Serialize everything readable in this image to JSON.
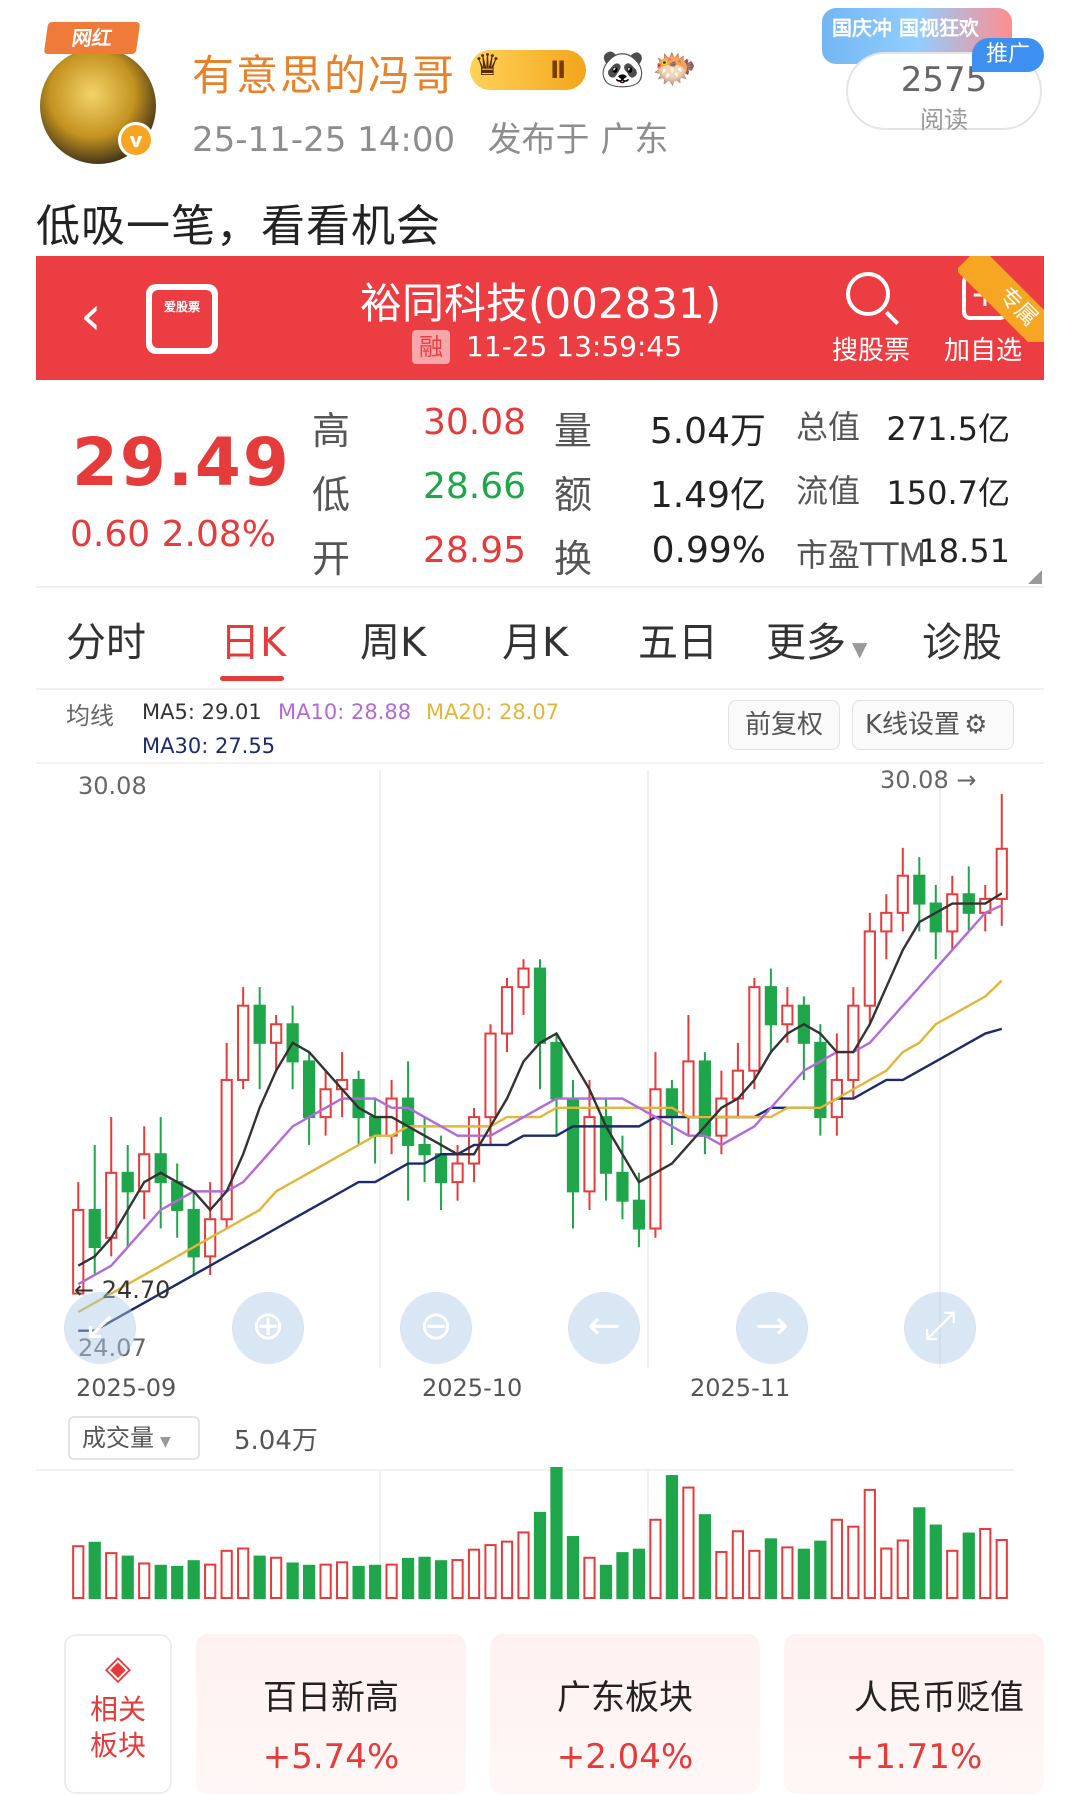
{
  "post": {
    "avatar_tag": "网红",
    "username": "有意思的冯哥",
    "level_badge": "Ⅱ",
    "timestamp": "25-11-25 14:00",
    "location": "发布于 广东",
    "ad_art_text": "国庆冲 国视狂欢",
    "ad_tag": "推广",
    "reads_count": "2575",
    "reads_label": "阅读",
    "text": "低吸一笔，看看机会"
  },
  "app": {
    "logo_text": "爱股票",
    "stock_title": "裕同科技(002831)",
    "margin_tag": "融",
    "quote_time": "11-25 13:59:45",
    "search_label": "搜股票",
    "add_label": "加自选",
    "vip_tag": "专属"
  },
  "quote": {
    "price": "29.49",
    "change": "0.60",
    "change_pct": "2.08%",
    "high_label": "高",
    "high": "30.08",
    "low_label": "低",
    "low": "28.66",
    "open_label": "开",
    "open": "28.95",
    "vol_label": "量",
    "vol": "5.04万",
    "amount_label": "额",
    "amount": "1.49亿",
    "turnover_label": "换",
    "turnover": "0.99%",
    "mktcap_label": "总值",
    "mktcap": "271.5亿",
    "float_label": "流值",
    "float_cap": "150.7亿",
    "pe_label": "市盈TTM",
    "pe": "18.51"
  },
  "tabs": [
    "分时",
    "日K",
    "周K",
    "月K",
    "五日",
    "更多",
    "诊股"
  ],
  "active_tab": "日K",
  "ma": {
    "label": "均线",
    "ma5": "MA5: 29.01",
    "ma10": "MA10: 28.88",
    "ma20": "MA20: 28.07",
    "ma30": "MA30: 27.55",
    "colors": {
      "ma5": "#333333",
      "ma10": "#b36ad8",
      "ma20": "#e3b53a",
      "ma30": "#1b2a6b"
    }
  },
  "buttons": {
    "adjust": "前复权",
    "kline_settings": "K线设置"
  },
  "chart_labels": {
    "top_left": "30.08",
    "top_right": "30.08 →",
    "low_marker": "← 24.70",
    "bottom_left": "24.07",
    "dates": [
      "2025-09",
      "2025-10",
      "2025-11"
    ]
  },
  "volume": {
    "selector": "成交量",
    "value": "5.04万"
  },
  "sectors_label": "相关板块",
  "sectors": [
    {
      "name": "百日新高",
      "change": "+5.74%"
    },
    {
      "name": "广东板块",
      "change": "+2.04%"
    },
    {
      "name": "人民币贬值",
      "change": "+1.71%"
    }
  ],
  "chart_data": {
    "type": "candlestick",
    "ylim": [
      24.07,
      30.08
    ],
    "x": [
      "2025-09",
      "2025-10",
      "2025-11"
    ],
    "up_color": "#e63b3b",
    "down_color": "#1fa64a",
    "candles": [
      [
        24.7,
        25.6,
        24.7,
        25.9
      ],
      [
        25.6,
        25.2,
        24.9,
        26.3
      ],
      [
        25.3,
        26.0,
        25.1,
        26.6
      ],
      [
        26.0,
        25.8,
        25.2,
        26.3
      ],
      [
        25.8,
        26.2,
        25.5,
        26.5
      ],
      [
        26.2,
        25.9,
        25.4,
        26.6
      ],
      [
        25.9,
        25.6,
        25.3,
        26.1
      ],
      [
        25.6,
        25.1,
        24.9,
        25.8
      ],
      [
        25.1,
        25.5,
        24.9,
        25.9
      ],
      [
        25.5,
        27.0,
        25.4,
        27.4
      ],
      [
        27.0,
        27.8,
        26.9,
        28.0
      ],
      [
        27.8,
        27.4,
        26.9,
        28.0
      ],
      [
        27.4,
        27.6,
        27.1,
        27.7
      ],
      [
        27.6,
        27.2,
        26.9,
        27.8
      ],
      [
        27.2,
        26.6,
        26.3,
        27.3
      ],
      [
        26.6,
        26.9,
        26.4,
        27.1
      ],
      [
        26.9,
        27.0,
        26.6,
        27.3
      ],
      [
        27.0,
        26.6,
        26.3,
        27.1
      ],
      [
        26.6,
        26.4,
        26.1,
        26.8
      ],
      [
        26.4,
        26.8,
        26.2,
        27.0
      ],
      [
        26.8,
        26.3,
        25.7,
        27.2
      ],
      [
        26.3,
        26.2,
        25.9,
        26.6
      ],
      [
        26.2,
        25.9,
        25.6,
        26.4
      ],
      [
        25.9,
        26.1,
        25.7,
        26.3
      ],
      [
        26.1,
        26.6,
        25.9,
        26.7
      ],
      [
        26.6,
        27.5,
        26.3,
        27.6
      ],
      [
        27.5,
        28.0,
        27.3,
        28.1
      ],
      [
        28.0,
        28.2,
        27.7,
        28.3
      ],
      [
        28.2,
        27.4,
        26.9,
        28.3
      ],
      [
        27.4,
        26.8,
        26.4,
        27.5
      ],
      [
        26.8,
        25.8,
        25.4,
        27.0
      ],
      [
        25.8,
        26.6,
        25.6,
        27.0
      ],
      [
        26.6,
        26.0,
        25.7,
        26.8
      ],
      [
        26.0,
        25.7,
        25.5,
        26.4
      ],
      [
        25.7,
        25.4,
        25.2,
        26.0
      ],
      [
        25.4,
        26.9,
        25.3,
        27.3
      ],
      [
        26.9,
        26.6,
        26.3,
        27.0
      ],
      [
        26.6,
        27.2,
        26.4,
        27.7
      ],
      [
        27.2,
        26.4,
        26.2,
        27.3
      ],
      [
        26.4,
        26.8,
        26.2,
        27.1
      ],
      [
        26.8,
        27.1,
        26.6,
        27.4
      ],
      [
        27.1,
        28.0,
        26.9,
        28.1
      ],
      [
        28.0,
        27.6,
        27.3,
        28.2
      ],
      [
        27.6,
        27.8,
        27.4,
        28.0
      ],
      [
        27.8,
        27.4,
        27.0,
        27.9
      ],
      [
        27.4,
        26.6,
        26.4,
        27.6
      ],
      [
        26.6,
        27.0,
        26.4,
        27.5
      ],
      [
        27.0,
        27.8,
        26.8,
        28.0
      ],
      [
        27.8,
        28.6,
        27.6,
        28.8
      ],
      [
        28.6,
        28.8,
        28.3,
        29.0
      ],
      [
        28.8,
        29.2,
        28.6,
        29.5
      ],
      [
        29.2,
        28.9,
        28.6,
        29.4
      ],
      [
        28.9,
        28.6,
        28.3,
        29.1
      ],
      [
        28.6,
        29.0,
        28.4,
        29.2
      ],
      [
        29.0,
        28.8,
        28.6,
        29.3
      ],
      [
        28.8,
        28.95,
        28.6,
        29.1
      ],
      [
        28.95,
        29.49,
        28.66,
        30.08
      ]
    ],
    "ma5": [
      25.0,
      25.1,
      25.3,
      25.6,
      25.9,
      26.0,
      25.9,
      25.8,
      25.6,
      25.8,
      26.2,
      26.7,
      27.1,
      27.4,
      27.3,
      27.1,
      26.9,
      26.7,
      26.6,
      26.6,
      26.5,
      26.4,
      26.3,
      26.2,
      26.2,
      26.5,
      26.8,
      27.2,
      27.4,
      27.5,
      27.2,
      26.9,
      26.5,
      26.2,
      25.9,
      26.0,
      26.1,
      26.3,
      26.5,
      26.7,
      26.8,
      27.0,
      27.3,
      27.5,
      27.6,
      27.5,
      27.3,
      27.3,
      27.6,
      28.0,
      28.4,
      28.7,
      28.8,
      28.9,
      28.9,
      28.9,
      29.01
    ],
    "ma10": [
      24.8,
      24.9,
      25.0,
      25.2,
      25.4,
      25.6,
      25.7,
      25.8,
      25.8,
      25.8,
      25.9,
      26.1,
      26.3,
      26.5,
      26.6,
      26.7,
      26.8,
      26.8,
      26.8,
      26.7,
      26.7,
      26.6,
      26.5,
      26.4,
      26.4,
      26.4,
      26.5,
      26.6,
      26.7,
      26.8,
      26.8,
      26.8,
      26.8,
      26.8,
      26.7,
      26.6,
      26.5,
      26.4,
      26.4,
      26.3,
      26.4,
      26.5,
      26.7,
      26.9,
      27.1,
      27.2,
      27.3,
      27.3,
      27.4,
      27.6,
      27.8,
      28.0,
      28.2,
      28.4,
      28.6,
      28.8,
      28.88
    ],
    "ma20": [
      24.5,
      24.6,
      24.7,
      24.8,
      24.9,
      25.0,
      25.1,
      25.2,
      25.3,
      25.4,
      25.5,
      25.6,
      25.8,
      25.9,
      26.0,
      26.1,
      26.2,
      26.3,
      26.4,
      26.4,
      26.5,
      26.5,
      26.5,
      26.5,
      26.5,
      26.5,
      26.6,
      26.6,
      26.6,
      26.7,
      26.7,
      26.7,
      26.7,
      26.7,
      26.7,
      26.7,
      26.7,
      26.6,
      26.6,
      26.6,
      26.6,
      26.6,
      26.6,
      26.7,
      26.7,
      26.7,
      26.8,
      26.9,
      27.0,
      27.1,
      27.3,
      27.4,
      27.6,
      27.7,
      27.8,
      27.9,
      28.07
    ],
    "ma30": [
      24.3,
      24.3,
      24.4,
      24.5,
      24.6,
      24.7,
      24.8,
      24.9,
      25.0,
      25.1,
      25.2,
      25.3,
      25.4,
      25.5,
      25.6,
      25.7,
      25.8,
      25.9,
      25.9,
      26.0,
      26.1,
      26.1,
      26.2,
      26.2,
      26.3,
      26.3,
      26.3,
      26.4,
      26.4,
      26.4,
      26.5,
      26.5,
      26.5,
      26.5,
      26.5,
      26.6,
      26.6,
      26.6,
      26.6,
      26.6,
      26.6,
      26.6,
      26.7,
      26.7,
      26.7,
      26.7,
      26.8,
      26.8,
      26.9,
      27.0,
      27.0,
      27.1,
      27.2,
      27.3,
      27.4,
      27.5,
      27.55
    ],
    "volume": [
      4.5,
      4.8,
      3.9,
      3.6,
      3.0,
      2.8,
      2.7,
      3.2,
      2.9,
      4.1,
      4.3,
      3.6,
      3.5,
      3.0,
      2.8,
      2.9,
      3.1,
      2.7,
      2.8,
      2.9,
      3.4,
      3.5,
      3.2,
      3.3,
      4.2,
      4.6,
      4.9,
      5.7,
      7.4,
      11.3,
      5.3,
      3.5,
      2.8,
      3.9,
      4.2,
      6.8,
      10.6,
      9.6,
      7.2,
      4.0,
      5.8,
      4.1,
      5.1,
      4.4,
      4.2,
      4.9,
      6.8,
      6.2,
      9.4,
      4.3,
      5.0,
      7.8,
      6.3,
      4.1,
      5.6,
      6.0,
      5.04
    ]
  }
}
